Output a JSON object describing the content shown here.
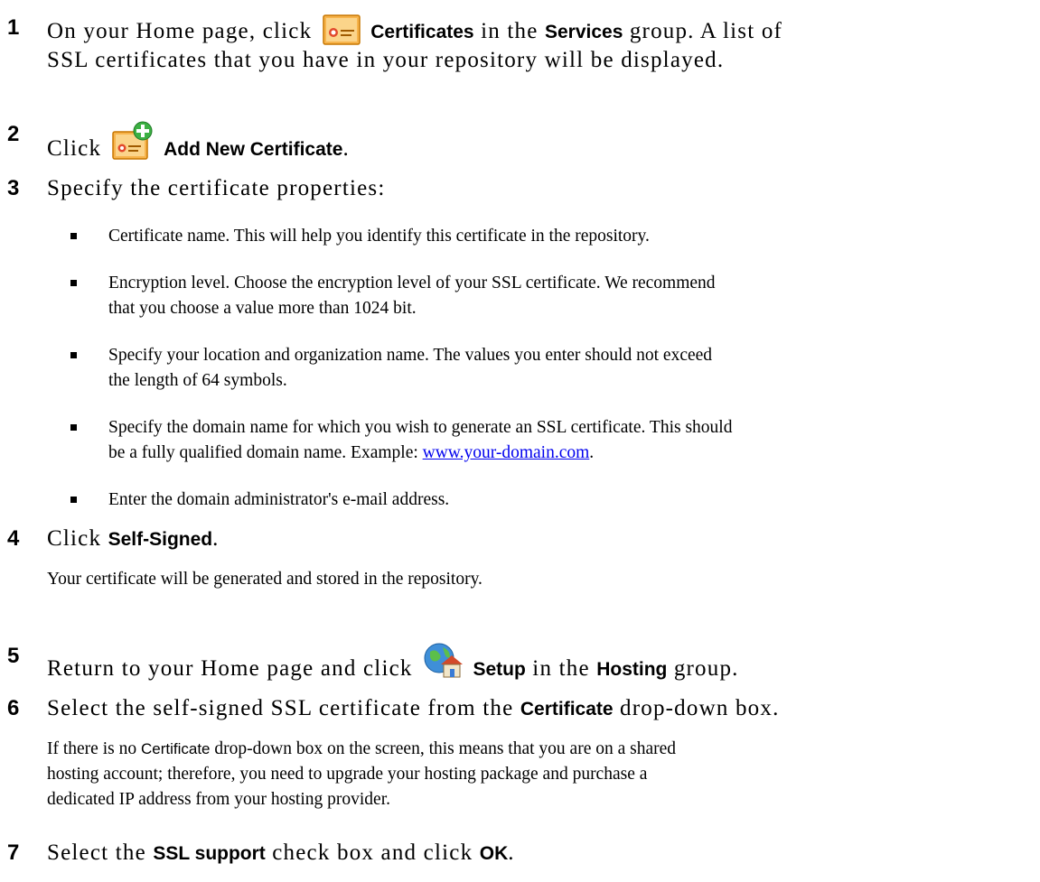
{
  "steps": {
    "s1": {
      "number": "1",
      "pre": "On your Home page, click",
      "icon": "certificate-icon",
      "ui_label": "Certificates",
      "mid": "in the",
      "ui_group": "Services",
      "post": "group. A list of",
      "line2": "SSL certificates that you have in your repository will be displayed."
    },
    "s2": {
      "number": "2",
      "pre": "Click",
      "icon": "add-certificate-icon",
      "ui_label": "Add New Certificate",
      "post": "."
    },
    "s3": {
      "number": "3",
      "text": "Specify the certificate properties:",
      "bullets": [
        {
          "line1": "Certificate name. This will help you identify this certificate in the repository."
        },
        {
          "line1": "Encryption level. Choose the encryption level of your SSL certificate. We recommend",
          "line2": "that you choose a value more than 1024 bit."
        },
        {
          "line1": "Specify your location and organization name. The values you enter should not exceed",
          "line2": "the length of 64 symbols."
        },
        {
          "line1": "Specify the domain name for which you wish to generate an SSL certificate. This should",
          "line2_pre": "be a fully qualified domain name. Example: ",
          "link": "www.your-domain.com",
          "line2_post": "."
        },
        {
          "line1": "Enter the domain administrator's e-mail address."
        }
      ]
    },
    "s4": {
      "number": "4",
      "pre": "Click",
      "ui_label": "Self-Signed",
      "post": ".",
      "note": "Your certificate will be generated and stored in the repository."
    },
    "s5": {
      "number": "5",
      "pre": "Return to your Home page and click",
      "icon": "hosting-setup-icon",
      "ui_label": "Setup",
      "mid": "in the",
      "ui_group": "Hosting",
      "post": "group."
    },
    "s6": {
      "number": "6",
      "pre": "Select the self-signed SSL certificate from the",
      "ui_label": "Certificate",
      "post": "drop-down box.",
      "note_pre": "If there is no",
      "note_ui": "Certificate",
      "note_line1_post": "drop-down box on the screen, this means that you are on a shared",
      "note_line2": "hosting account; therefore, you need to upgrade your hosting package and purchase a",
      "note_line3": "dedicated IP address from your hosting provider."
    },
    "s7": {
      "number": "7",
      "pre": "Select the",
      "ui_label": "SSL support",
      "mid": "check box and click",
      "ui_ok": "OK",
      "post": "."
    }
  },
  "colors": {
    "text": "#000000",
    "link": "#0000ee",
    "certificate_orange": "#f5a623",
    "add_green": "#3cb043"
  }
}
